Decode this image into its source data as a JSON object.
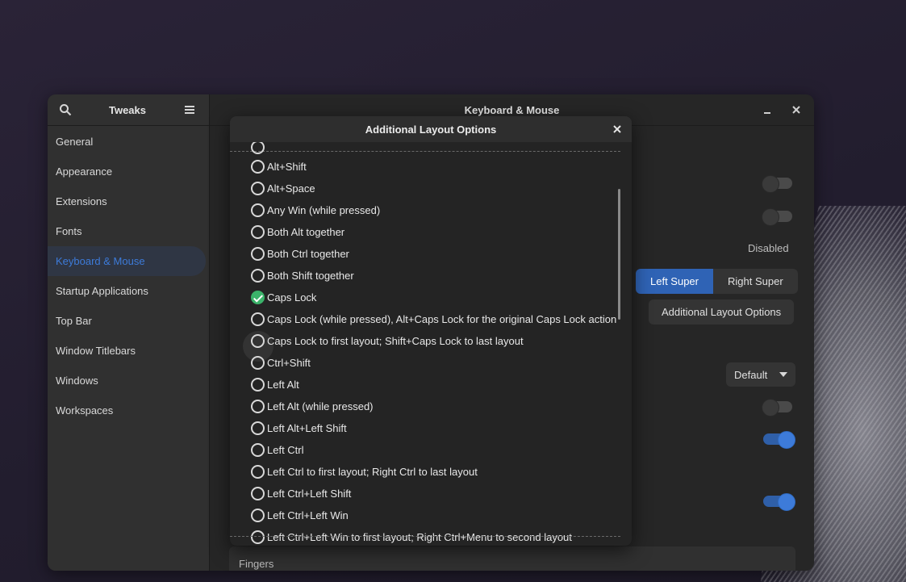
{
  "app": {
    "title": "Tweaks",
    "page_title": "Keyboard & Mouse"
  },
  "sidebar": {
    "items": [
      {
        "label": "General"
      },
      {
        "label": "Appearance"
      },
      {
        "label": "Extensions"
      },
      {
        "label": "Fonts"
      },
      {
        "label": "Keyboard & Mouse",
        "active": true
      },
      {
        "label": "Startup Applications"
      },
      {
        "label": "Top Bar"
      },
      {
        "label": "Window Titlebars"
      },
      {
        "label": "Windows"
      },
      {
        "label": "Workspaces"
      }
    ]
  },
  "content": {
    "disabled_label": "Disabled",
    "super_key": {
      "left": "Left Super",
      "right": "Right Super",
      "selected": "Left Super"
    },
    "additional_layout_button": "Additional Layout Options",
    "dropdown_value": "Default",
    "fingers_label": "Fingers",
    "toggles": [
      false,
      false,
      false,
      true,
      true
    ]
  },
  "dialog": {
    "title": "Additional Layout Options",
    "options": [
      {
        "label": "Alt+Shift",
        "checked": false
      },
      {
        "label": "Alt+Space",
        "checked": false
      },
      {
        "label": "Any Win (while pressed)",
        "checked": false
      },
      {
        "label": "Both Alt together",
        "checked": false
      },
      {
        "label": "Both Ctrl together",
        "checked": false
      },
      {
        "label": "Both Shift together",
        "checked": false
      },
      {
        "label": "Caps Lock",
        "checked": true
      },
      {
        "label": "Caps Lock (while pressed), Alt+Caps Lock for the original Caps Lock action",
        "checked": false
      },
      {
        "label": "Caps Lock to first layout; Shift+Caps Lock to last layout",
        "checked": false
      },
      {
        "label": "Ctrl+Shift",
        "checked": false
      },
      {
        "label": "Left Alt",
        "checked": false
      },
      {
        "label": "Left Alt (while pressed)",
        "checked": false
      },
      {
        "label": "Left Alt+Left Shift",
        "checked": false
      },
      {
        "label": "Left Ctrl",
        "checked": false
      },
      {
        "label": "Left Ctrl to first layout; Right Ctrl to last layout",
        "checked": false
      },
      {
        "label": "Left Ctrl+Left Shift",
        "checked": false
      },
      {
        "label": "Left Ctrl+Left Win",
        "checked": false
      },
      {
        "label": "Left Ctrl+Left Win to first layout; Right Ctrl+Menu to second layout",
        "checked": false
      }
    ]
  },
  "icons": {
    "search": "search-icon",
    "menu": "hamburger-menu-icon",
    "minimize": "minimize-icon",
    "close": "close-icon"
  },
  "colors": {
    "accent": "#3d7bd9",
    "check": "#3bb36a"
  }
}
